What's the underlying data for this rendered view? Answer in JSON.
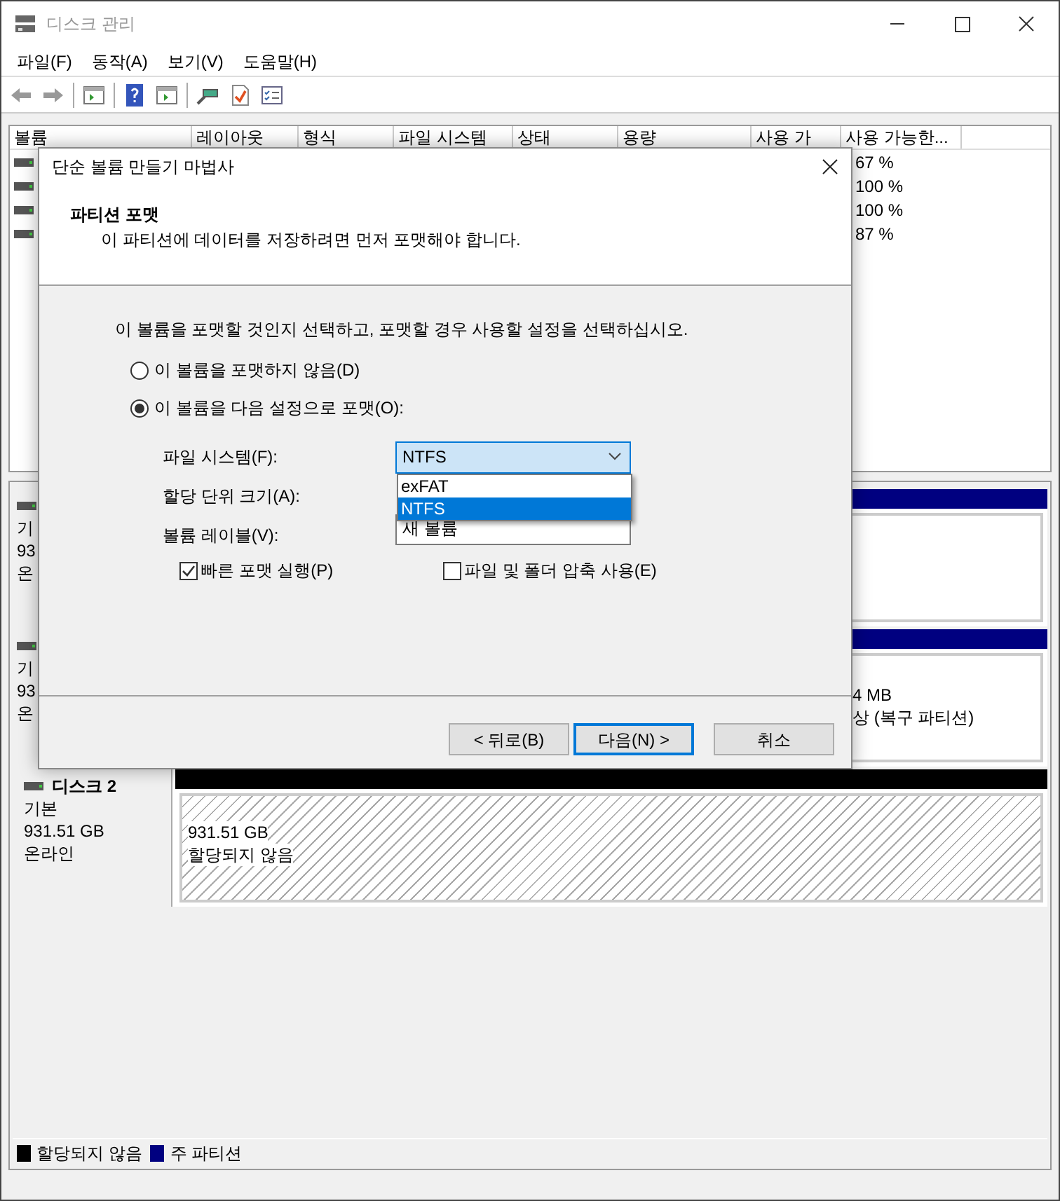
{
  "window": {
    "title": "디스크 관리"
  },
  "menu": [
    "파일(F)",
    "동작(A)",
    "보기(V)",
    "도움말(H)"
  ],
  "volume_list": {
    "columns": [
      "볼륨",
      "레이아웃",
      "형식",
      "파일 시스템",
      "상태",
      "용량",
      "사용 가",
      "사용 가능한..."
    ],
    "available_pct": [
      "67 %",
      "100 %",
      "100 %",
      "87 %"
    ]
  },
  "disks": [
    {
      "kind": "partial",
      "label_lines": [
        "기",
        "93",
        "온"
      ],
      "partition": {
        "kind": "primary"
      }
    },
    {
      "kind": "partial",
      "label_lines": [
        "기",
        "93",
        "온"
      ],
      "partition": {
        "kind": "primary",
        "lines": [
          "4 MB",
          "상 (복구 파티션)"
        ]
      }
    },
    {
      "kind": "full",
      "name": "디스크 2",
      "label_lines": [
        "기본",
        "931.51 GB",
        "온라인"
      ],
      "partition": {
        "kind": "unallocated",
        "lines": [
          "931.51 GB",
          "할당되지 않음"
        ]
      }
    }
  ],
  "legend": [
    {
      "label": "할당되지 않음",
      "color": "#000000"
    },
    {
      "label": "주 파티션",
      "color": "#000080"
    }
  ],
  "dialog": {
    "title": "단순 볼륨 만들기 마법사",
    "header_title": "파티션 포맷",
    "header_subtitle": "이 파티션에 데이터를 저장하려면 먼저 포맷해야 합니다.",
    "instruction": "이 볼륨을 포맷할 것인지 선택하고, 포맷할 경우 사용할 설정을 선택하십시오.",
    "options": [
      {
        "label": "이 볼륨을 포맷하지 않음(D)",
        "selected": false
      },
      {
        "label": "이 볼륨을 다음 설정으로 포맷(O):",
        "selected": true
      }
    ],
    "fields": [
      {
        "label": "파일 시스템(F):",
        "kind": "combo",
        "value": "NTFS"
      },
      {
        "label": "할당 단위 크기(A):",
        "kind": "covered"
      },
      {
        "label": "볼륨 레이블(V):",
        "kind": "text",
        "value": "새 볼륨"
      }
    ],
    "dropdown_items": [
      {
        "label": "exFAT",
        "selected": false
      },
      {
        "label": "NTFS",
        "selected": true
      }
    ],
    "checkboxes": [
      {
        "label": "빠른 포맷 실행(P)",
        "checked": true
      },
      {
        "label": "파일 및 폴더 압축 사용(E)",
        "checked": false
      }
    ],
    "buttons": [
      {
        "label": "< 뒤로(B)",
        "default": false
      },
      {
        "label": "다음(N) >",
        "default": true
      },
      {
        "label": "취소",
        "default": false
      }
    ]
  }
}
